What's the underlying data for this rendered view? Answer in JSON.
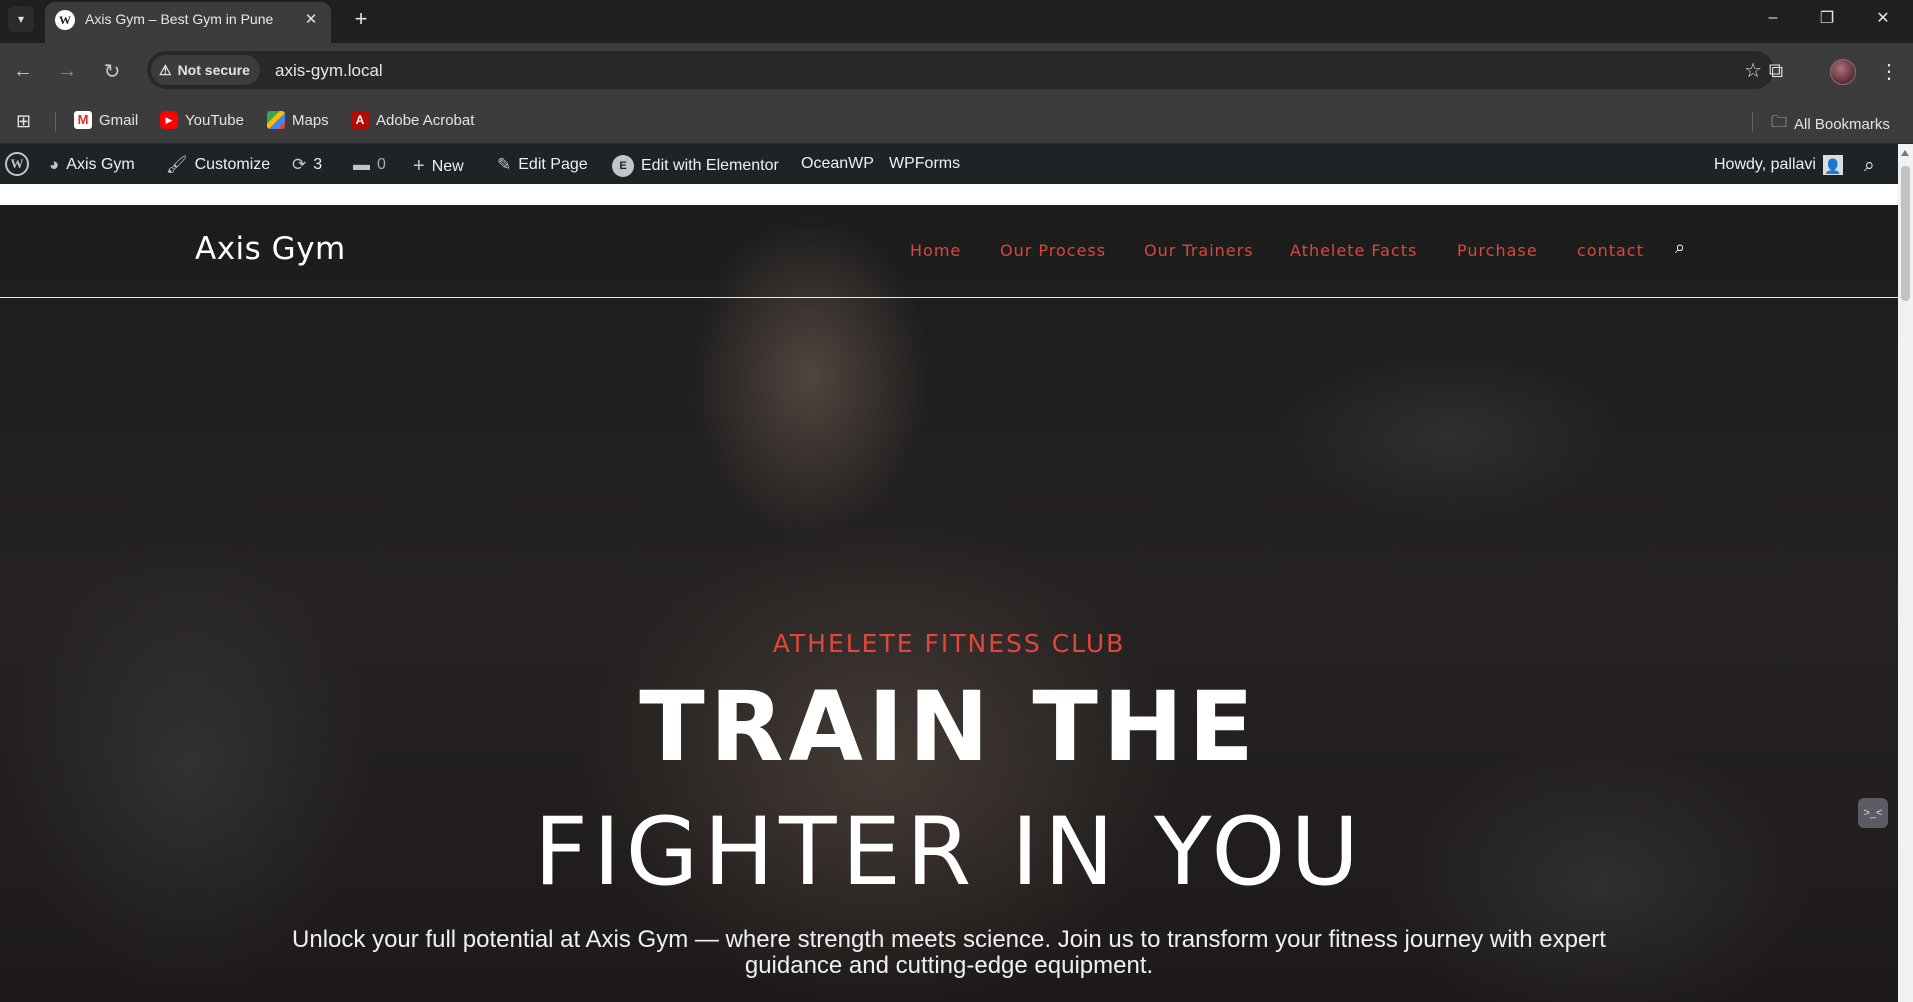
{
  "browser": {
    "tab": {
      "title": "Axis Gym – Best Gym in Pune",
      "favicon_text": "W"
    },
    "new_tab_icon": "+",
    "window_controls": [
      "–",
      "❐",
      "✕"
    ],
    "omnibox": {
      "security_label": "Not secure",
      "url": "axis-gym.local"
    },
    "bookmarks": [
      "Gmail",
      "YouTube",
      "Maps",
      "Adobe Acrobat"
    ],
    "all_bookmarks_label": "All Bookmarks"
  },
  "admin_bar": {
    "site_name": "Axis Gym",
    "customize": "Customize",
    "updates_count": "3",
    "comments_count": "0",
    "new": "New",
    "edit_page": "Edit Page",
    "edit_elementor": "Edit with Elementor",
    "oceanwp": "OceanWP",
    "wpforms": "WPForms",
    "howdy": "Howdy, pallavi"
  },
  "site": {
    "logo": "Axis Gym",
    "nav": [
      "Home",
      "Our Process",
      "Our Trainers",
      "Athelete Facts",
      "Purchase",
      "contact"
    ],
    "hero": {
      "kicker": "ATHELETE FITNESS CLUB",
      "title_line1": "TRAIN THE",
      "title_line2": "FIGHTER IN YOU",
      "lead": "Unlock your full potential at Axis Gym — where strength meets science. Join us to transform your fitness journey with expert guidance and cutting-edge equipment."
    }
  },
  "colors": {
    "nav_accent": "#d9473d",
    "kicker": "#e0463b",
    "admin_bar": "#1d2327",
    "browser_toolbar": "#3c3c3c"
  }
}
